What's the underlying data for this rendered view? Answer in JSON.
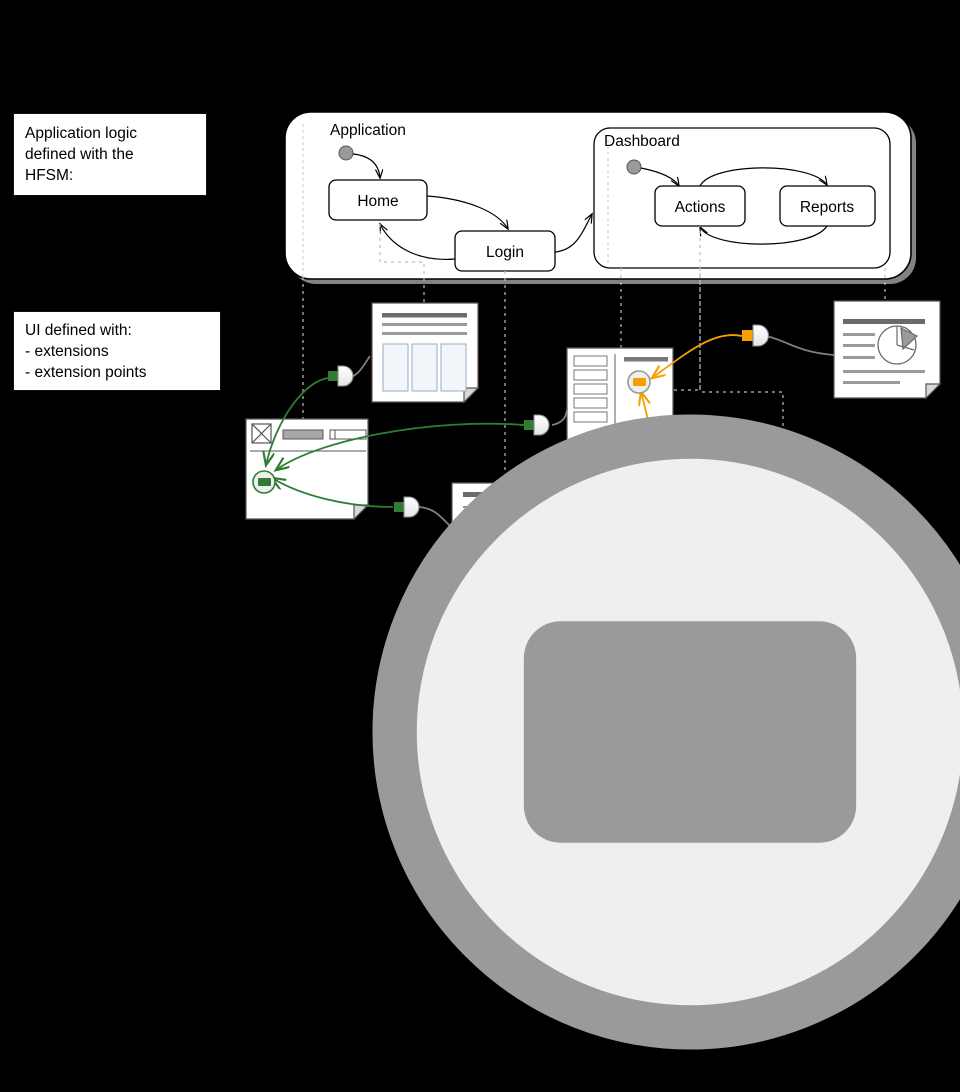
{
  "legend": {
    "logic": {
      "lines": [
        "Application logic",
        "defined with the",
        "HFSM:"
      ]
    },
    "ui": {
      "title": "UI defined with:",
      "items": [
        {
          "label": "- extensions",
          "icon": "extension-plug-icon"
        },
        {
          "label": "- extension points",
          "icon": "extension-point-icon"
        }
      ]
    }
  },
  "hfsm": {
    "outer_region": "Application",
    "states": [
      {
        "id": "home",
        "label": "Home"
      },
      {
        "id": "login",
        "label": "Login"
      }
    ],
    "nested_region": {
      "label": "Dashboard",
      "states": [
        {
          "id": "actions",
          "label": "Actions"
        },
        {
          "id": "reports",
          "label": "Reports"
        }
      ]
    },
    "initial_markers": 2
  },
  "colors": {
    "extension_green": "#2e7d32",
    "extension_orange": "#F5A000",
    "connector_gray": "#808080",
    "trace_dotted": "#bdbdbd",
    "wireframe_border": "#555555",
    "page_background": "#000000",
    "surface": "#ffffff"
  },
  "wireframes": [
    {
      "id": "wf-columns",
      "name": "three-column-page",
      "kind": "content-columns"
    },
    {
      "id": "wf-header",
      "name": "header-nav-page",
      "kind": "nav-bar-with-extension-point"
    },
    {
      "id": "wf-form",
      "name": "form-page",
      "kind": "form-with-buttons"
    },
    {
      "id": "wf-sidebar",
      "name": "sidebar-page",
      "kind": "sidebar-with-extension-point"
    },
    {
      "id": "wf-pie",
      "name": "pie-report-page",
      "kind": "pie-chart-report"
    },
    {
      "id": "wf-process",
      "name": "process-chart-page",
      "kind": "chevron-and-line-chart"
    }
  ]
}
